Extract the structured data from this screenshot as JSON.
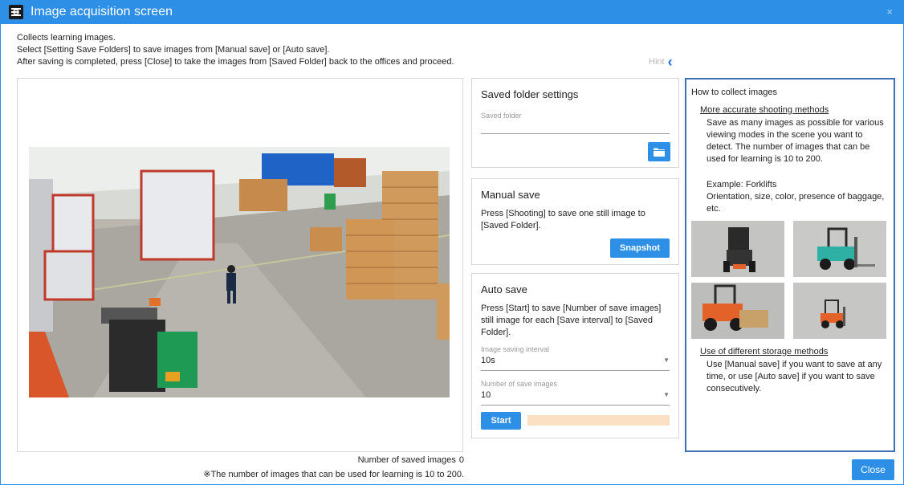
{
  "window": {
    "title": "Image acquisition screen",
    "close_glyph": "×"
  },
  "intro": {
    "line1": "Collects learning images.",
    "line2": "Select [Setting Save Folders] to save images from [Manual save] or [Auto save].",
    "line3": "After saving is completed, press [Close] to take the images from [Saved Folder] back to the offices and proceed."
  },
  "hint": {
    "label": "Hint",
    "icon": "chevron-left-icon"
  },
  "preview": {
    "saved_count_label": "Number of saved images",
    "saved_count_value": "0",
    "note": "※The number of images that can be used for learning is 10 to 200."
  },
  "folder_settings": {
    "title": "Saved folder settings",
    "field_label": "Saved folder",
    "field_value": "",
    "button_icon": "folder-icon"
  },
  "manual_save": {
    "title": "Manual save",
    "text1": "Press [Shooting] to save one still image to",
    "text2": "[Saved Folder].",
    "button": "Snapshot"
  },
  "auto_save": {
    "title": "Auto save",
    "text1": "Press [Start] to save [Number of save images]",
    "text2": "still image for each [Save interval] to [Saved",
    "text3": "Folder].",
    "interval_label": "Image saving interval",
    "interval_value": "10s",
    "count_label": "Number of save images",
    "count_value": "10",
    "start_button": "Start",
    "progress": 0
  },
  "howto": {
    "title": "How to collect images",
    "section1_title": "More accurate shooting methods",
    "section1_l1": "Save as many images as possible for various",
    "section1_l2": "viewing modes in the scene you want to",
    "section1_l3": "detect. The number of images that can be",
    "section1_l4": "used for learning is 10 to 200.",
    "example_l1": "Example: Forklifts",
    "example_l2": "Orientation, size, color, presence of baggage,",
    "example_l3": "etc.",
    "section2_title": "Use of different storage methods",
    "section2_l1": "Use [Manual save] if you want to save at any",
    "section2_l2": "time, or use [Auto save] if you want to save",
    "section2_l3": "consecutively."
  },
  "footer": {
    "close_button": "Close"
  },
  "colors": {
    "accent": "#2e8fe6",
    "howto_border": "#3f6fb6",
    "progress_track": "#fbe0c3"
  }
}
